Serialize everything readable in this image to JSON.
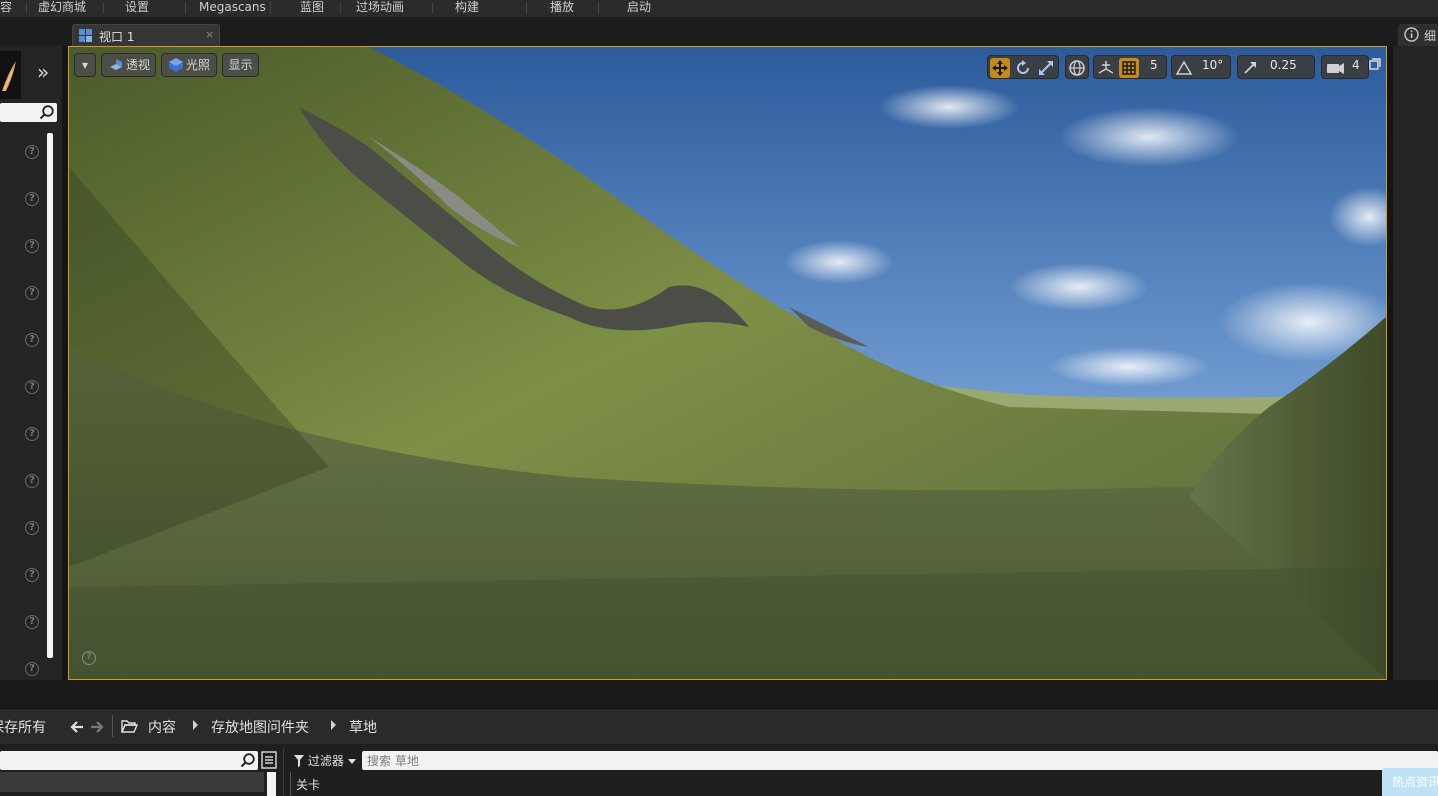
{
  "menu": {
    "items": [
      "内容",
      "虚幻商城",
      "设置",
      "Megascans",
      "蓝图",
      "过场动画",
      "构建",
      "播放",
      "启动"
    ]
  },
  "viewport_tab": {
    "label": "视口 1",
    "close": "×"
  },
  "viewport": {
    "view_dropdown": "▾",
    "perspective_label": "透视",
    "lighting_label": "光照",
    "show_label": "显示",
    "grid_snap_value": "5",
    "rotation_snap_value": "10°",
    "scale_snap_value": "0.25",
    "camera_speed_value": "4",
    "corner_help": "?",
    "active_color": "#c48a1d",
    "border_color": "#d19a2a"
  },
  "left_panel": {
    "expand_glyph": "»",
    "help_glyph": "?",
    "help_icon_count": 12
  },
  "right_panel": {
    "tab_label": "细"
  },
  "content_browser": {
    "save_all_label": "保存所有",
    "breadcrumb": [
      "内容",
      "存放地图问件夹",
      "草地"
    ],
    "filter_label": "过滤器",
    "search_placeholder": "搜索 草地",
    "level_item": "关卡",
    "hot_news_label": "热点资讯"
  }
}
